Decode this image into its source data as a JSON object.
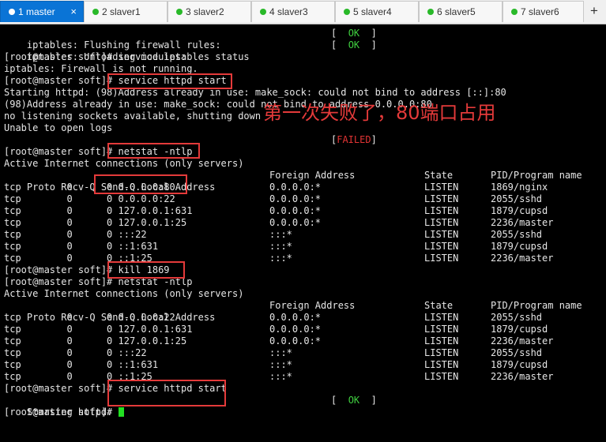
{
  "tabs": [
    {
      "label": "1 master",
      "active": true
    },
    {
      "label": "2 slaver1"
    },
    {
      "label": "3 slaver2"
    },
    {
      "label": "4 slaver3"
    },
    {
      "label": "5 slaver4"
    },
    {
      "label": "6 slaver5"
    },
    {
      "label": "7 slaver6"
    }
  ],
  "new_tab_label": "+",
  "close_glyph": "×",
  "annotation": "第一次失败了，80端口占用",
  "status": {
    "ok": "OK",
    "failed": "FAILED",
    "open": "[",
    "close": "]"
  },
  "terminal": {
    "l1": "iptables: Flushing firewall rules:",
    "l2": "iptables: Unloading modules:",
    "l3": "[root@master soft]# service iptables status",
    "l4": "iptables: Firewall is not running.",
    "l5_prompt": "[root@master soft]# ",
    "l5_cmd": "service httpd start",
    "l6": "Starting httpd: (98)Address already in use: make_sock: could not bind to address [::]:80",
    "l7": "(98)Address already in use: make_sock: could not bind to address 0.0.0.0:80",
    "l8": "no listening sockets available, shutting down",
    "l9": "Unable to open logs",
    "l11_prompt": "[root@master soft]# ",
    "l11_cmd": "netstat -ntlp",
    "active_conn": "Active Internet connections (only servers)",
    "header": {
      "proto": "Proto Recv-Q Send-Q Local Address",
      "foreign": "Foreign Address",
      "state": "State",
      "pid": "PID/Program name"
    },
    "netstat1": [
      {
        "left": "tcp        0      0 0.0.0.0:80",
        "foreign": "0.0.0.0:*",
        "state": "LISTEN",
        "pid": "1869/nginx"
      },
      {
        "left": "tcp        0      0 0.0.0.0:22",
        "foreign": "0.0.0.0:*",
        "state": "LISTEN",
        "pid": "2055/sshd"
      },
      {
        "left": "tcp        0      0 127.0.0.1:631",
        "foreign": "0.0.0.0:*",
        "state": "LISTEN",
        "pid": "1879/cupsd"
      },
      {
        "left": "tcp        0      0 127.0.0.1:25",
        "foreign": "0.0.0.0:*",
        "state": "LISTEN",
        "pid": "2236/master"
      },
      {
        "left": "tcp        0      0 :::22",
        "foreign": ":::*",
        "state": "LISTEN",
        "pid": "2055/sshd"
      },
      {
        "left": "tcp        0      0 ::1:631",
        "foreign": ":::*",
        "state": "LISTEN",
        "pid": "1879/cupsd"
      },
      {
        "left": "tcp        0      0 ::1:25",
        "foreign": ":::*",
        "state": "LISTEN",
        "pid": "2236/master"
      }
    ],
    "kill_prompt": "[root@master soft]# ",
    "kill_cmd": "kill 1869",
    "l_netstat2": "[root@master soft]# netstat -ntlp",
    "netstat2": [
      {
        "left": "tcp        0      0 0.0.0.0:22",
        "foreign": "0.0.0.0:*",
        "state": "LISTEN",
        "pid": "2055/sshd"
      },
      {
        "left": "tcp        0      0 127.0.0.1:631",
        "foreign": "0.0.0.0:*",
        "state": "LISTEN",
        "pid": "1879/cupsd"
      },
      {
        "left": "tcp        0      0 127.0.0.1:25",
        "foreign": "0.0.0.0:*",
        "state": "LISTEN",
        "pid": "2236/master"
      },
      {
        "left": "tcp        0      0 :::22",
        "foreign": ":::*",
        "state": "LISTEN",
        "pid": "2055/sshd"
      },
      {
        "left": "tcp        0      0 ::1:631",
        "foreign": ":::*",
        "state": "LISTEN",
        "pid": "1879/cupsd"
      },
      {
        "left": "tcp        0      0 ::1:25",
        "foreign": ":::*",
        "state": "LISTEN",
        "pid": "2236/master"
      }
    ],
    "start2_prompt": "[root@master soft]# ",
    "start2_cmd": "service httpd start",
    "starting": "Starting httpd:",
    "final_prompt": "[root@master soft]# "
  }
}
